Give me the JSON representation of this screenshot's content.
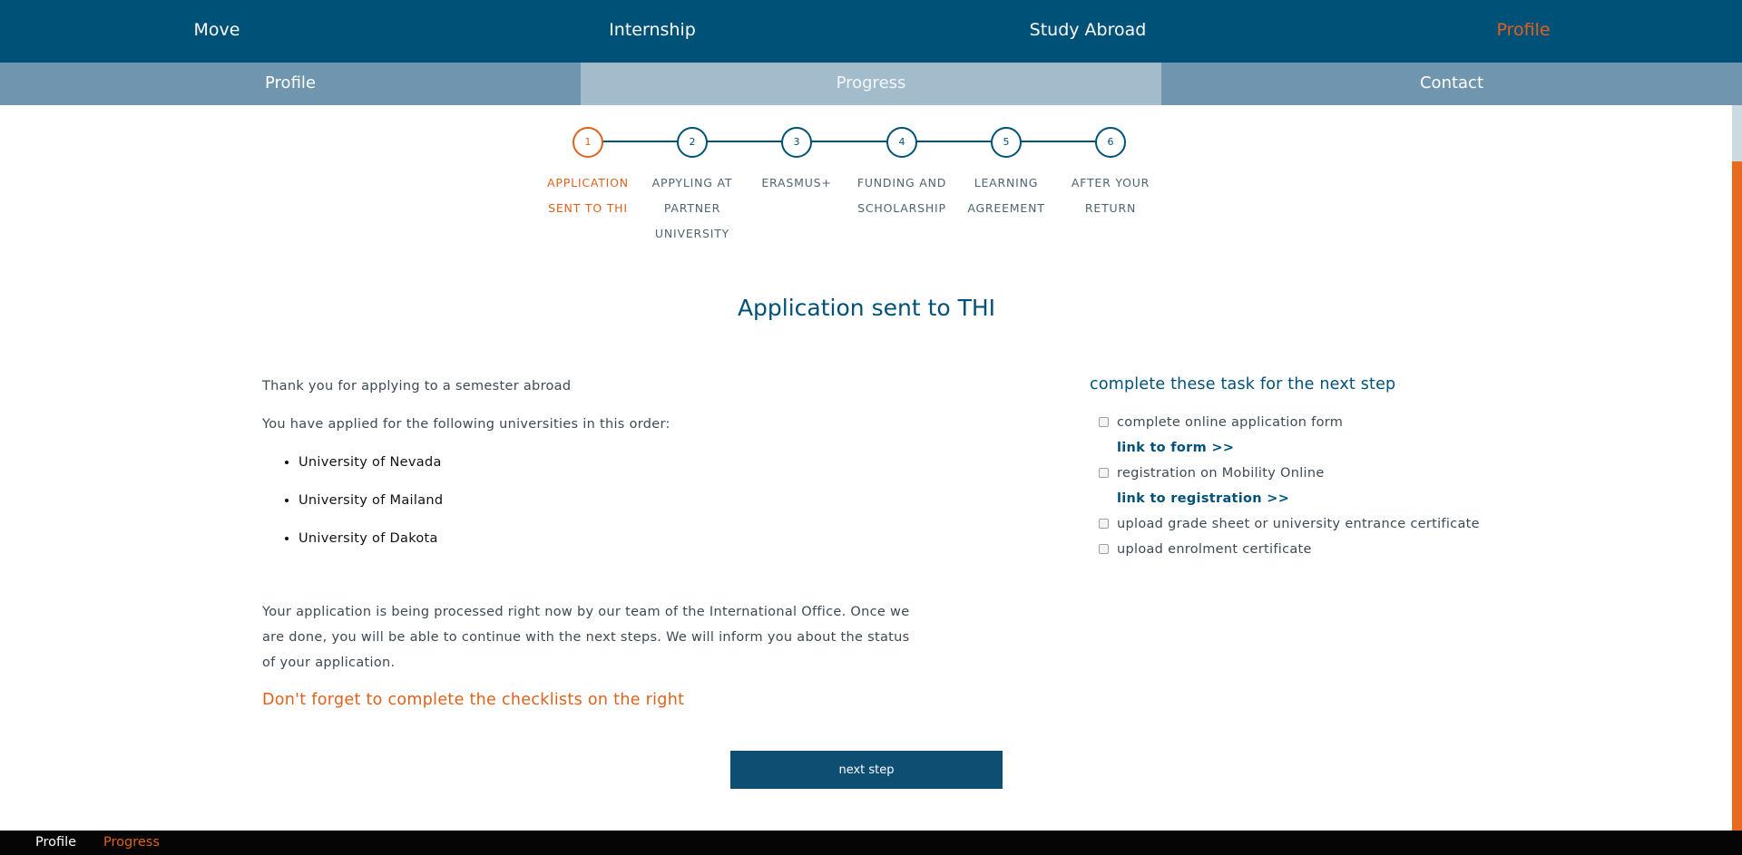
{
  "topnav": {
    "items": [
      {
        "label": "Move"
      },
      {
        "label": "Internship"
      },
      {
        "label": "Study Abroad"
      },
      {
        "label": "Profile"
      }
    ]
  },
  "subnav": {
    "tabs": [
      {
        "label": "Profile"
      },
      {
        "label": "Progress"
      },
      {
        "label": "Contact"
      }
    ]
  },
  "stepper": {
    "active_step": 1,
    "steps": [
      {
        "number": "1",
        "label": "APPLICATION SENT TO THI"
      },
      {
        "number": "2",
        "label": "APPYLING AT PARTNER UNIVERSITY"
      },
      {
        "number": "3",
        "label": "ERASMUS+"
      },
      {
        "number": "4",
        "label": "FUNDING AND SCHOLARSHIP"
      },
      {
        "number": "5",
        "label": "LEARNING AGREEMENT"
      },
      {
        "number": "6",
        "label": "AFTER YOUR RETURN"
      }
    ]
  },
  "main": {
    "title": "Application sent to THI",
    "thanks": "Thank you for applying to a semester abroad",
    "applied_intro": "You have applied for the following universities in this order:",
    "universities": [
      "University of Nevada",
      "University of Mailand",
      "University of Dakota"
    ],
    "processing": "Your application is being processed right now by our team of the International Office. Once we are done, you will be able to continue with the next steps. We will inform you about the status of your application.",
    "reminder": "Don't forget to complete the checklists on the right",
    "next_button": "next step"
  },
  "checklist": {
    "heading": "complete these task for the next step",
    "tasks": [
      {
        "label": "complete online application form",
        "link": "link to form >>",
        "checked": false
      },
      {
        "label": "registration on Mobility Online",
        "link": "link to registration >>",
        "checked": false
      },
      {
        "label": "upload grade sheet or university entrance certificate",
        "checked": false
      },
      {
        "label": "upload enrolment certificate",
        "checked": false
      }
    ]
  },
  "bottombar": {
    "items": [
      {
        "label": "Profile"
      },
      {
        "label": "Progress"
      }
    ]
  },
  "colors": {
    "primary": "#005177",
    "accent": "#e0611c",
    "subnav": "#6f96ae",
    "subnav_active": "#a3bccb"
  }
}
